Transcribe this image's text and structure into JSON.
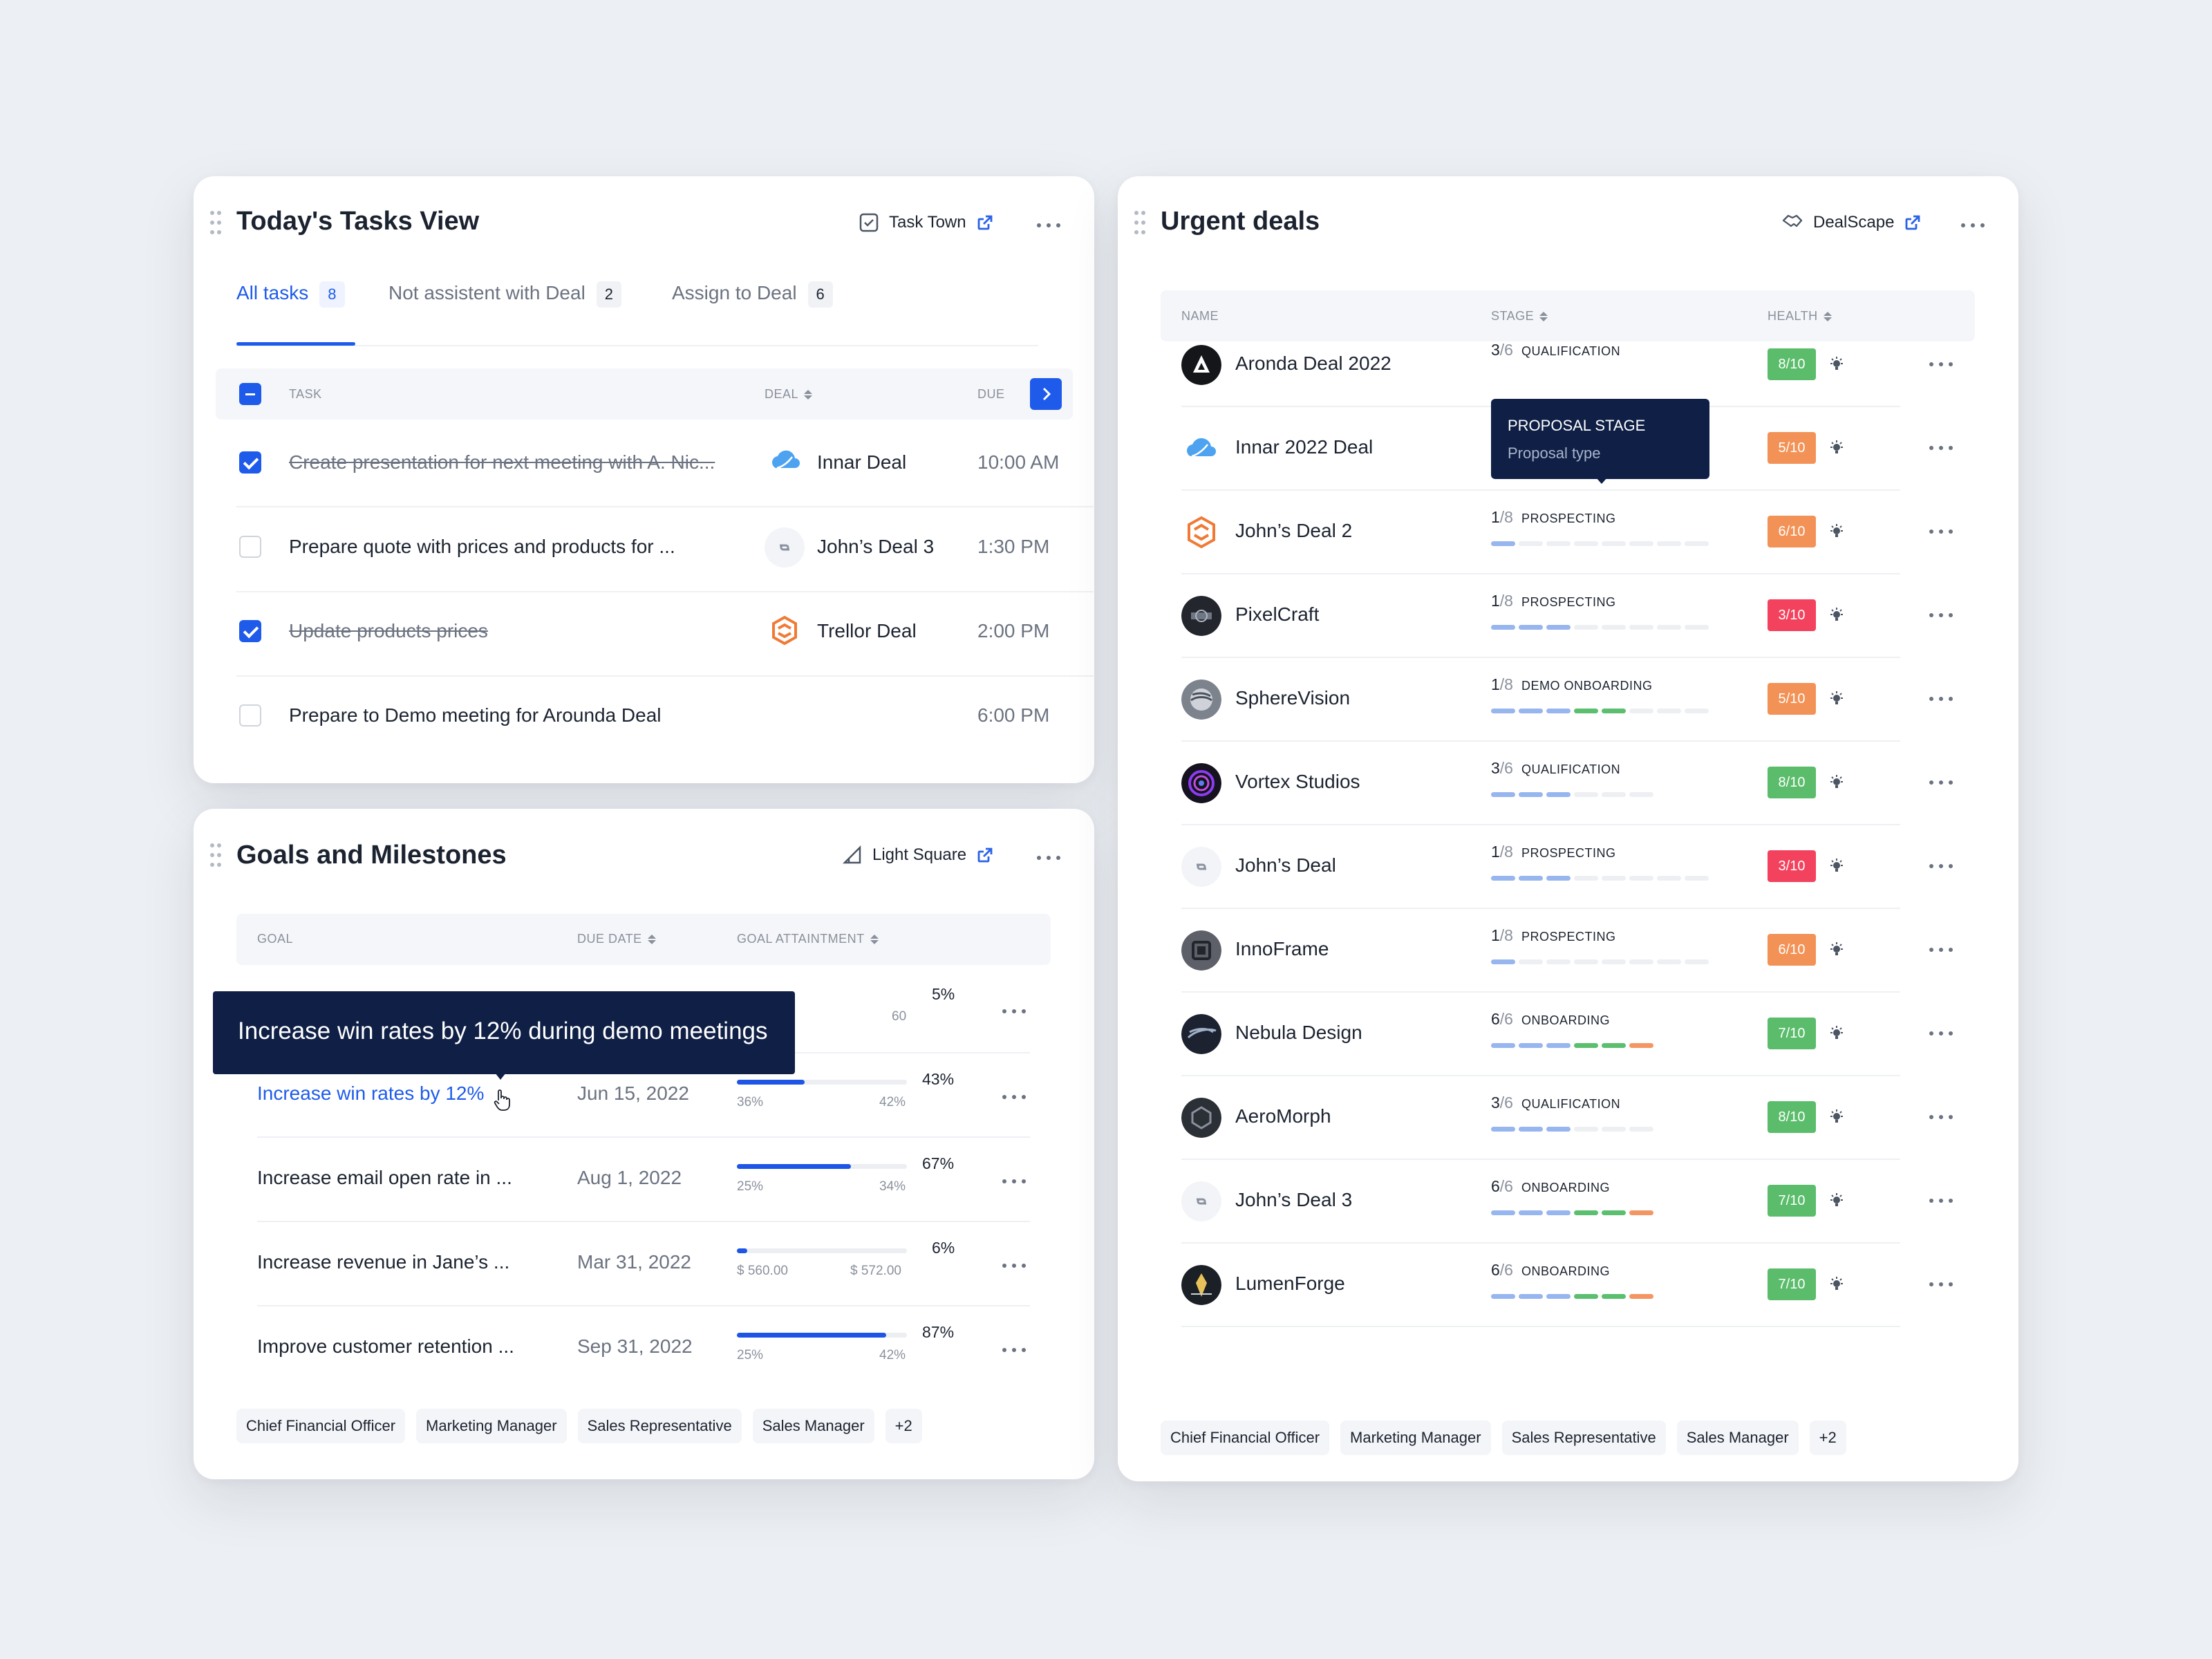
{
  "tasks": {
    "title": "Today's Tasks View",
    "source": "Task Town",
    "tabs": [
      {
        "label": "All tasks",
        "count": "8"
      },
      {
        "label": "Not assistent with Deal",
        "count": "2"
      },
      {
        "label": "Assign to Deal",
        "count": "6"
      }
    ],
    "columns": {
      "task": "TASK",
      "deal": "DEAL",
      "due": "DUE"
    },
    "rows": [
      {
        "task": "Create presentation for next meeting with A. Nic...",
        "deal": "Innar Deal",
        "time": "10:00 AM",
        "done": true
      },
      {
        "task": "Prepare quote with prices and products for ...",
        "deal": "John’s Deal 3",
        "time": "1:30 PM",
        "done": false
      },
      {
        "task": "Update products prices",
        "deal": "Trellor Deal",
        "time": "2:00 PM",
        "done": true
      },
      {
        "task": "Prepare to Demo meeting for Arounda Deal",
        "deal": "",
        "time": "6:00 PM",
        "done": false
      }
    ]
  },
  "goals": {
    "title": "Goals and Milestones",
    "source": "Light Square",
    "columns": {
      "goal": "GOAL",
      "due": "DUE DATE",
      "attain": "GOAL ATTAINTMENT"
    },
    "tooltip": "Increase win rates by 12% during demo meetings",
    "rows": [
      {
        "goal": "",
        "due": "",
        "pct": "5%",
        "fill": 0.05,
        "low": "",
        "high": "60"
      },
      {
        "goal": "Increase win rates by 12%",
        "due": "Jun 15, 2022",
        "pct": "43%",
        "fill": 0.4,
        "low": "36%",
        "high": "42%"
      },
      {
        "goal": "Increase email open rate in ...",
        "due": "Aug 1, 2022",
        "pct": "67%",
        "fill": 0.67,
        "low": "25%",
        "high": "34%"
      },
      {
        "goal": "Increase revenue in Jane’s ...",
        "due": "Mar 31, 2022",
        "pct": "6%",
        "fill": 0.06,
        "low": "$ 560.00",
        "high": "$ 572.00"
      },
      {
        "goal": "Improve customer retention ...",
        "due": "Sep 31, 2022",
        "pct": "87%",
        "fill": 0.88,
        "low": "25%",
        "high": "42%"
      }
    ],
    "chips": [
      "Chief Financial Officer",
      "Marketing Manager",
      "Sales Representative",
      "Sales Manager",
      "+2"
    ]
  },
  "deals": {
    "title": "Urgent deals",
    "source": "DealScape",
    "columns": {
      "name": "NAME",
      "stage": "STAGE",
      "health": "HEALTH"
    },
    "tooltip": {
      "title": "PROPOSAL STAGE",
      "sub": "Proposal type"
    },
    "rows": [
      {
        "name": "Aronda Deal 2022",
        "num": "3",
        "den": "/6",
        "stage": "QUALIFICATION",
        "health": "8/10",
        "tone": "g",
        "segs": "",
        "logo": "aronda"
      },
      {
        "name": "Innar 2022 Deal",
        "num": "",
        "den": "",
        "stage": "",
        "health": "5/10",
        "tone": "o",
        "segs": "bbbggnnn",
        "logo": "cloud"
      },
      {
        "name": "John’s Deal 2",
        "num": "1",
        "den": "/8",
        "stage": "PROSPECTING",
        "health": "6/10",
        "tone": "o",
        "segs": "bnnnnnnn",
        "logo": "trellor"
      },
      {
        "name": "PixelCraft",
        "num": "1",
        "den": "/8",
        "stage": "PROSPECTING",
        "health": "3/10",
        "tone": "r",
        "segs": "bbbnnnnn",
        "logo": "pixel"
      },
      {
        "name": "SphereVision",
        "num": "1",
        "den": "/8",
        "stage": "DEMO ONBOARDING",
        "health": "5/10",
        "tone": "o",
        "segs": "bbbggnnn",
        "logo": "sphere"
      },
      {
        "name": "Vortex Studios",
        "num": "3",
        "den": "/6",
        "stage": "QUALIFICATION",
        "health": "8/10",
        "tone": "g",
        "segs": "bbbnnn",
        "logo": "vortex"
      },
      {
        "name": "John’s Deal",
        "num": "1",
        "den": "/8",
        "stage": "PROSPECTING",
        "health": "3/10",
        "tone": "r",
        "segs": "bbbnnnnn",
        "logo": "john"
      },
      {
        "name": "InnoFrame",
        "num": "1",
        "den": "/8",
        "stage": "PROSPECTING",
        "health": "6/10",
        "tone": "o",
        "segs": "bnnnnnnn",
        "logo": "inno"
      },
      {
        "name": "Nebula Design",
        "num": "6",
        "den": "/6",
        "stage": "ONBOARDING",
        "health": "7/10",
        "tone": "g",
        "segs": "bbbggo",
        "logo": "nebula"
      },
      {
        "name": "AeroMorph",
        "num": "3",
        "den": "/6",
        "stage": "QUALIFICATION",
        "health": "8/10",
        "tone": "g",
        "segs": "bbbnnn",
        "logo": "aero"
      },
      {
        "name": "John’s Deal 3",
        "num": "6",
        "den": "/6",
        "stage": "ONBOARDING",
        "health": "7/10",
        "tone": "g",
        "segs": "bbbggo",
        "logo": "john"
      },
      {
        "name": "LumenForge",
        "num": "6",
        "den": "/6",
        "stage": "ONBOARDING",
        "health": "7/10",
        "tone": "g",
        "segs": "bbbggo",
        "logo": "lumen"
      }
    ],
    "chips": [
      "Chief Financial Officer",
      "Marketing Manager",
      "Sales Representative",
      "Sales Manager",
      "+2"
    ]
  },
  "colors": {
    "accent": "#1e5bea",
    "tooltip_bg": "#0f1f45",
    "health_good": "#5bbd6c",
    "health_mid": "#f39256",
    "health_bad": "#f3425d"
  }
}
